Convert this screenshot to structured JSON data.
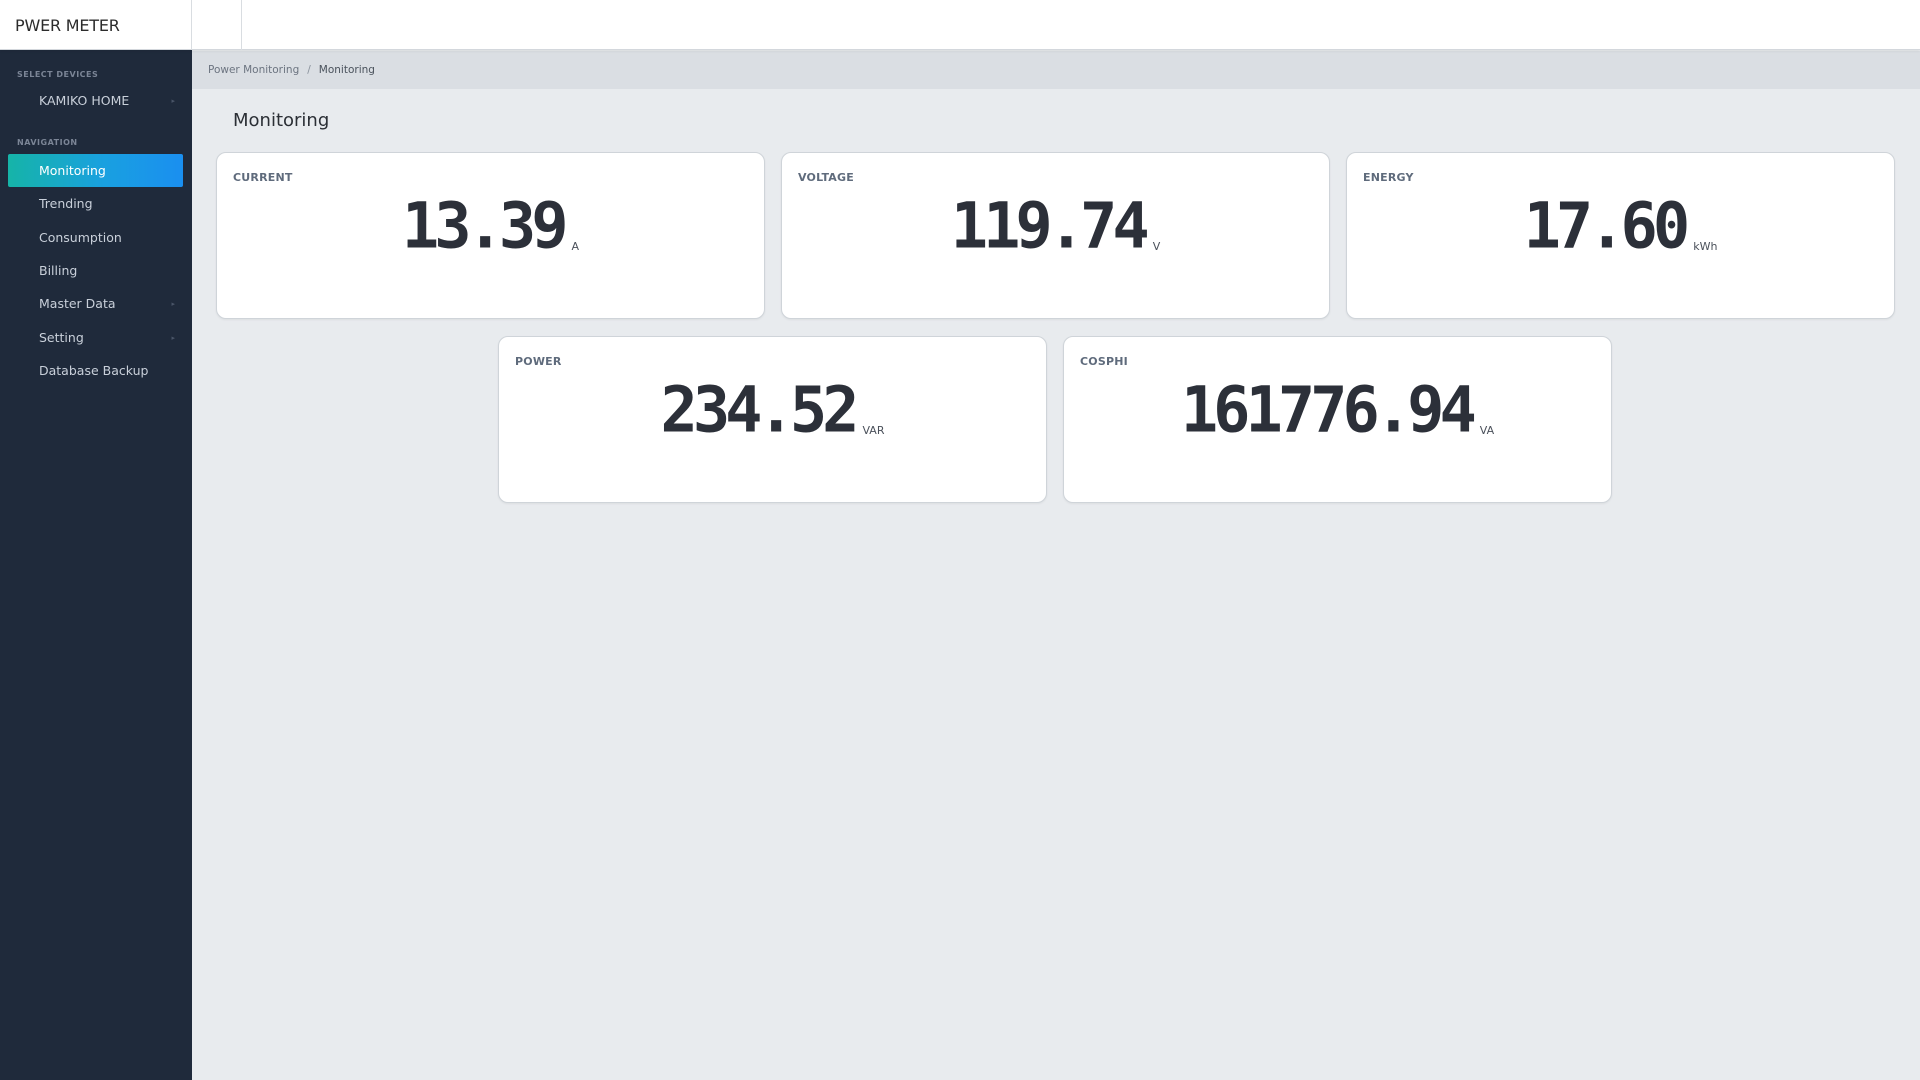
{
  "app": {
    "brand": "PWER METER"
  },
  "sidebar": {
    "device_heading": "SELECT DEVICES",
    "device": {
      "label": "KAMIKO HOME"
    },
    "nav_heading": "NAVIGATION",
    "items": [
      {
        "label": "Monitoring",
        "active": true
      },
      {
        "label": "Trending"
      },
      {
        "label": "Consumption"
      },
      {
        "label": "Billing"
      },
      {
        "label": "Master Data"
      },
      {
        "label": "Setting"
      },
      {
        "label": "Database Backup"
      }
    ]
  },
  "breadcrumb": {
    "root": "Power Monitoring",
    "separator": "/",
    "current": "Monitoring"
  },
  "page": {
    "title": "Monitoring"
  },
  "cards": [
    {
      "label": "CURRENT",
      "value": "13.39",
      "unit": "A"
    },
    {
      "label": "VOLTAGE",
      "value": "119.74",
      "unit": "V"
    },
    {
      "label": "ENERGY",
      "value": "17.60",
      "unit": "kWh"
    },
    {
      "label": "POWER",
      "value": "234.52",
      "unit": "VAR"
    },
    {
      "label": "COSPHI",
      "value": "161776.94",
      "unit": "VA"
    }
  ],
  "colors": {
    "sidebar_bg": "#1f2a3b",
    "active_gradient_start": "#16b4a8",
    "active_gradient_end": "#1a8ff0",
    "content_bg": "#e8ebee"
  }
}
